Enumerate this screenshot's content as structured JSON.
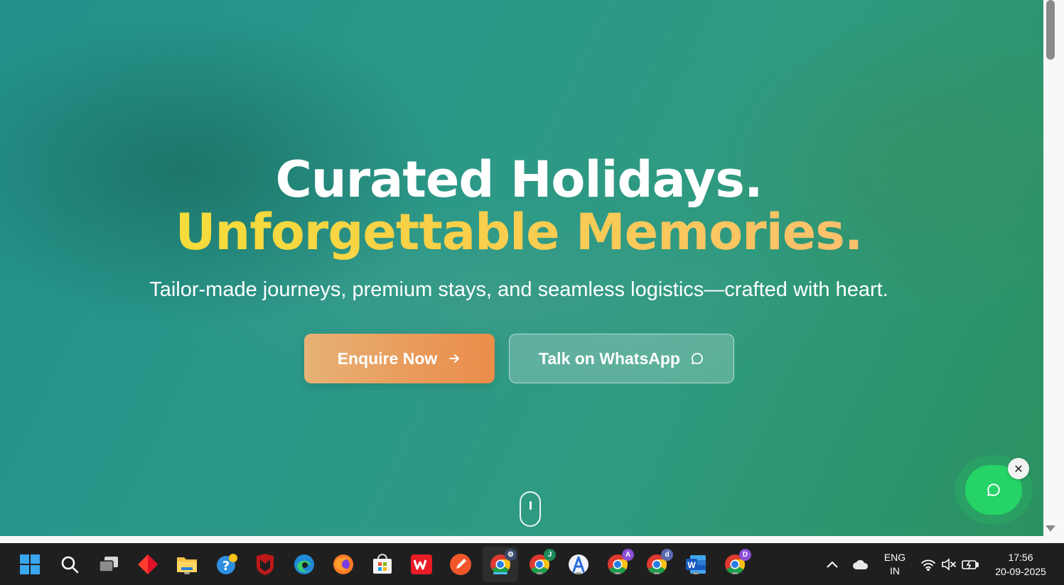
{
  "hero": {
    "headline_line1": "Curated Holidays.",
    "headline_line2": "Unforgettable Memories.",
    "subtitle": "Tailor-made journeys, premium stays, and seamless logistics—crafted with heart."
  },
  "buttons": {
    "enquire_label": "Enquire Now",
    "whatsapp_label": "Talk on WhatsApp"
  },
  "floating_whatsapp": {
    "close_glyph": "✕"
  },
  "taskbar": {
    "apps": [
      {
        "name": "start-icon"
      },
      {
        "name": "search-icon"
      },
      {
        "name": "task-view-icon"
      },
      {
        "name": "diamond-app-icon"
      },
      {
        "name": "file-explorer-icon"
      },
      {
        "name": "get-help-icon"
      },
      {
        "name": "mcafee-icon"
      },
      {
        "name": "edge-icon"
      },
      {
        "name": "firefox-icon"
      },
      {
        "name": "microsoft-store-icon"
      },
      {
        "name": "wps-office-icon"
      },
      {
        "name": "pen-app-icon"
      },
      {
        "name": "chrome-icon"
      },
      {
        "name": "chrome-profile-j-icon",
        "badge": "J"
      },
      {
        "name": "android-studio-icon"
      },
      {
        "name": "chrome-profile-a-icon",
        "badge": "A"
      },
      {
        "name": "chrome-profile-d-icon",
        "badge": "d"
      },
      {
        "name": "word-icon"
      },
      {
        "name": "chrome-profile-d2-icon",
        "badge": "D"
      }
    ],
    "language_line1": "ENG",
    "language_line2": "IN",
    "time": "17:56",
    "date": "20-09-2025"
  },
  "colors": {
    "accent_gold": "#f4dd3a",
    "enquire_orange": "#e99a5a",
    "whatsapp_green": "#25d366",
    "taskbar_bg": "#1f1f1f"
  }
}
